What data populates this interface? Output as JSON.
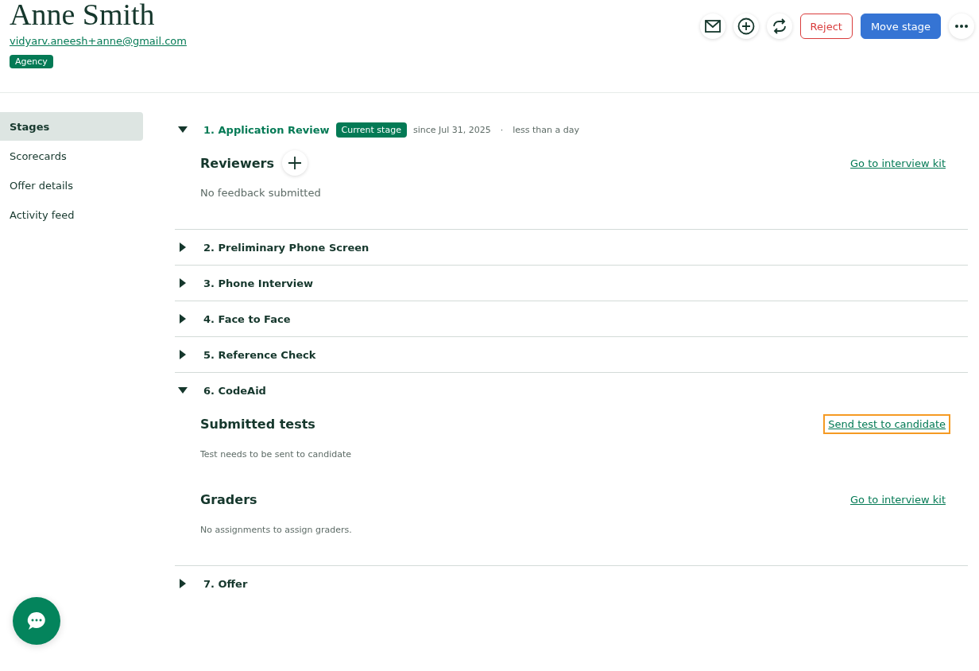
{
  "candidate": {
    "name": "Anne Smith",
    "email": "vidyarv.aneesh+anne@gmail.com",
    "tag": "Agency"
  },
  "actions": {
    "reject": "Reject",
    "move": "Move stage"
  },
  "sidebar": {
    "items": [
      {
        "label": "Stages",
        "selected": true
      },
      {
        "label": "Scorecards",
        "selected": false
      },
      {
        "label": "Offer details",
        "selected": false
      },
      {
        "label": "Activity feed",
        "selected": false
      }
    ]
  },
  "stages": [
    {
      "title": "1. Application Review",
      "expanded": true,
      "current": true,
      "badge": "Current stage",
      "since": "since Jul 31, 2025",
      "separator": "·",
      "duration": "less than a day",
      "sections": [
        {
          "kind": "feedback",
          "title": "Reviewers",
          "add_button": true,
          "link": "Go to interview kit",
          "link_focused": false,
          "note": "No feedback submitted"
        }
      ]
    },
    {
      "title": "2. Preliminary Phone Screen",
      "expanded": false,
      "current": false
    },
    {
      "title": "3. Phone Interview",
      "expanded": false,
      "current": false
    },
    {
      "title": "4. Face to Face",
      "expanded": false,
      "current": false
    },
    {
      "title": "5. Reference Check",
      "expanded": false,
      "current": false
    },
    {
      "title": "6. CodeAid",
      "expanded": true,
      "current": false,
      "sections": [
        {
          "kind": "assignment",
          "title": "Submitted tests",
          "add_button": false,
          "link": "Send test to candidate",
          "link_focused": true,
          "note": "Test needs to be sent to candidate"
        },
        {
          "kind": "assignment",
          "title": "Graders",
          "add_button": false,
          "link": "Go to interview kit",
          "link_focused": false,
          "note": "No assignments to assign graders."
        }
      ]
    },
    {
      "title": "7. Offer",
      "expanded": false,
      "current": false
    }
  ]
}
